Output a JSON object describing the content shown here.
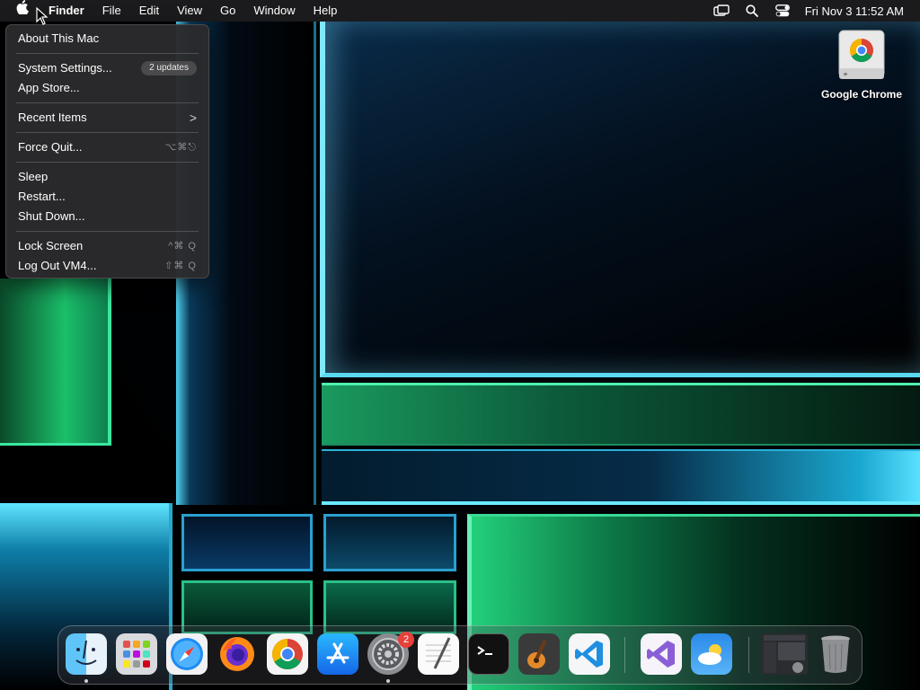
{
  "menubar": {
    "app_name": "Finder",
    "menus": [
      "File",
      "Edit",
      "View",
      "Go",
      "Window",
      "Help"
    ],
    "clock": "Fri Nov 3  11:52 AM",
    "status_icons": [
      "screen-mirroring-icon",
      "search-icon",
      "control-center-icon"
    ]
  },
  "apple_menu": {
    "items": [
      {
        "label": "About This Mac"
      },
      {
        "label": "System Settings...",
        "badge": "2 updates"
      },
      {
        "label": "App Store..."
      },
      {
        "label": "Recent Items",
        "submenu_arrow": ">"
      },
      {
        "label": "Force Quit...",
        "shortcut": "⌥⌘⎋"
      },
      {
        "label": "Sleep"
      },
      {
        "label": "Restart..."
      },
      {
        "label": "Shut Down..."
      },
      {
        "label": "Lock Screen",
        "shortcut": "^⌘ Q"
      },
      {
        "label": "Log Out VM4...",
        "shortcut": "⇧⌘ Q"
      }
    ]
  },
  "desktop": {
    "icons": [
      {
        "label": "Google Chrome",
        "icon": "chrome-drive-icon"
      }
    ]
  },
  "dock": {
    "apps": [
      {
        "name": "Finder",
        "icon": "finder-icon",
        "running": true
      },
      {
        "name": "Launchpad",
        "icon": "launchpad-icon",
        "running": false
      },
      {
        "name": "Safari",
        "icon": "safari-icon",
        "running": false
      },
      {
        "name": "Firefox",
        "icon": "firefox-icon",
        "running": false
      },
      {
        "name": "Google Chrome",
        "icon": "chrome-icon",
        "running": false
      },
      {
        "name": "App Store",
        "icon": "app-store-icon",
        "running": false
      },
      {
        "name": "System Settings",
        "icon": "system-settings-icon",
        "running": true,
        "badge": "2"
      },
      {
        "name": "TextEdit",
        "icon": "textedit-icon",
        "running": false
      },
      {
        "name": "Terminal",
        "icon": "terminal-icon",
        "running": false
      },
      {
        "name": "GarageBand",
        "icon": "garageband-icon",
        "running": false
      },
      {
        "name": "Visual Studio Code",
        "icon": "vscode-icon",
        "running": false
      },
      {
        "name": "Visual Studio",
        "icon": "visual-studio-icon",
        "running": false
      },
      {
        "name": "Weather",
        "icon": "weather-icon",
        "running": false
      },
      {
        "name": "Recent Window",
        "icon": "window-thumbnail-icon",
        "running": false
      },
      {
        "name": "Trash",
        "icon": "trash-icon",
        "running": false
      }
    ]
  }
}
